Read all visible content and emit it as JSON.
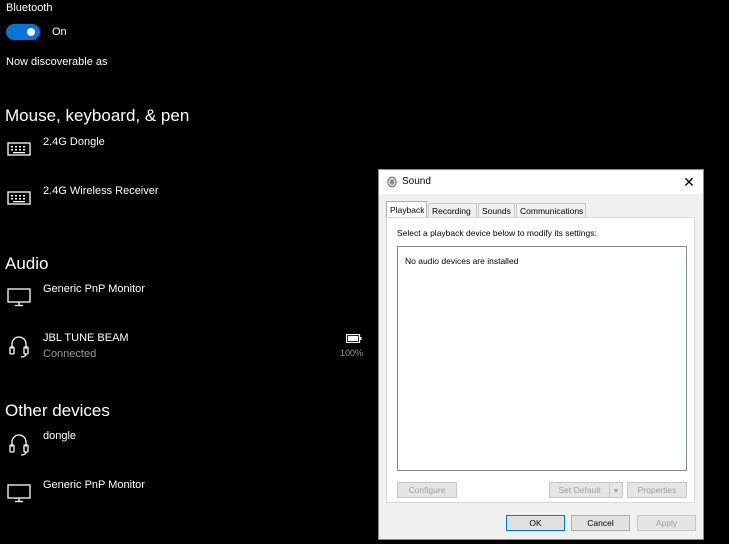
{
  "bluetooth": {
    "label": "Bluetooth",
    "toggle_state": "On",
    "discoverable_text": "Now discoverable as"
  },
  "sections": {
    "mkp": "Mouse, keyboard, & pen",
    "audio": "Audio",
    "other": "Other devices"
  },
  "devices": {
    "dongle_kbd": {
      "name": "2.4G Dongle",
      "icon": "keyboard-icon"
    },
    "wireless_receiver": {
      "name": "2.4G Wireless Receiver",
      "icon": "keyboard-icon"
    },
    "generic_monitor_audio": {
      "name": "Generic PnP Monitor",
      "icon": "monitor-icon"
    },
    "jbl": {
      "name": "JBL TUNE BEAM",
      "status": "Connected",
      "battery": "100%",
      "icon": "headset-icon"
    },
    "dongle_other": {
      "name": "dongle",
      "icon": "headset-icon"
    },
    "generic_monitor_other": {
      "name": "Generic PnP Monitor",
      "icon": "monitor-icon"
    }
  },
  "dialog": {
    "title": "Sound",
    "tabs": [
      "Playback",
      "Recording",
      "Sounds",
      "Communications"
    ],
    "active_tab": "Playback",
    "instruction": "Select a playback device below to modify its settings:",
    "empty_message": "No audio devices are installed",
    "buttons": {
      "configure": "Configure",
      "set_default": "Set Default",
      "properties": "Properties",
      "ok": "OK",
      "cancel": "Cancel",
      "apply": "Apply"
    }
  },
  "colors": {
    "toggle_accent": "#0a74d8",
    "background": "#000000",
    "muted_text": "#9a9a9a"
  }
}
